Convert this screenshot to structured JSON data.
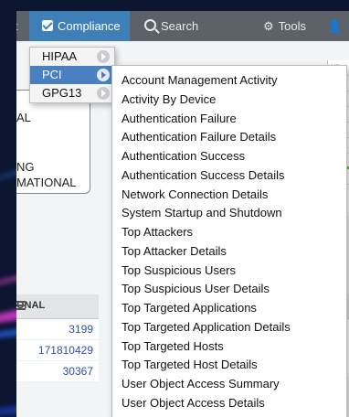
{
  "colors": {
    "topbar": "#5d6168",
    "active_tab": "#3f7fb8",
    "menu_highlight": "#4a7fc1",
    "link_value": "#2f4fa8"
  },
  "topbar": {
    "prev_fragment": "t",
    "compliance_label": "Compliance",
    "search_label": "Search",
    "tools_label": "Tools"
  },
  "compliance_menu": {
    "items": [
      {
        "label": "HIPAA"
      },
      {
        "label": "PCI"
      },
      {
        "label": "GPG13"
      }
    ],
    "active_item": "PCI"
  },
  "pci_submenu": {
    "items": [
      "Account Management Activity",
      "Activity By Device",
      "Authentication Failure",
      "Authentication Failure Details",
      "Authentication Success",
      "Authentication Success Details",
      "Network Connection Details",
      "System Startup and Shutdown",
      "Top Attackers",
      "Top Attacker Details",
      "Top Suspicious Users",
      "Top Suspicious User Details",
      "Top Targeted Applications",
      "Top Targeted Application Details",
      "Top Targeted Hosts",
      "Top Targeted Host Details",
      "User Object Access Summary",
      "User Object Access Details"
    ]
  },
  "background_panel": {
    "line1": "AL",
    "line2": "NG",
    "line3": "MATIONAL"
  },
  "background_table": {
    "header": "ONAL",
    "rows": [
      "3199",
      "171810429",
      "30367"
    ]
  },
  "right_edge_fragment": "ur"
}
